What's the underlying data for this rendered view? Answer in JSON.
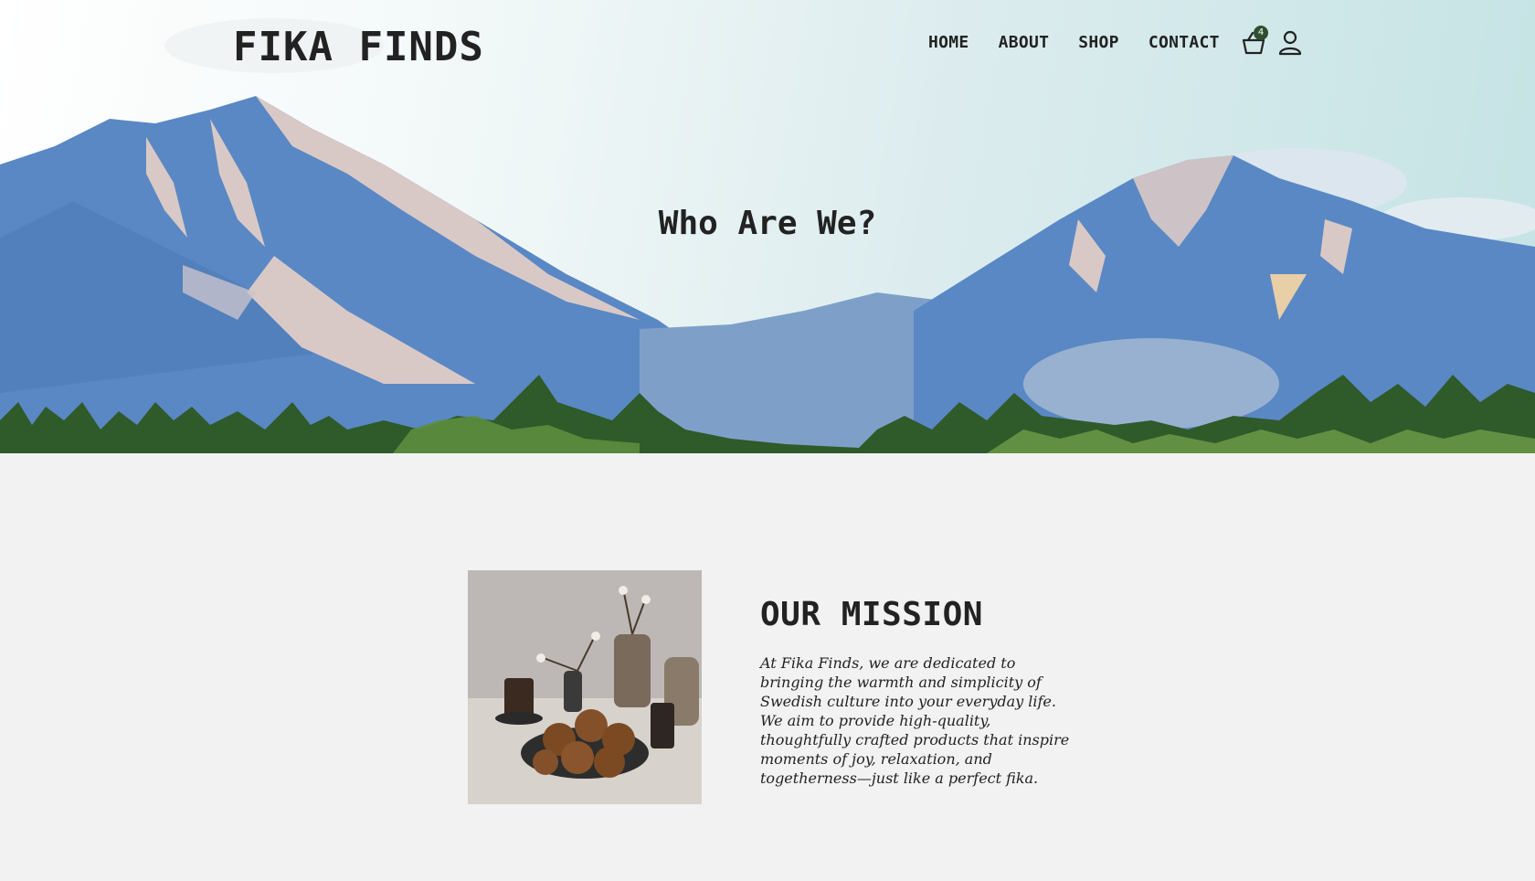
{
  "brand": {
    "name": "FIKA FINDS"
  },
  "nav": {
    "links": [
      "HOME",
      "ABOUT",
      "SHOP",
      "CONTACT"
    ],
    "cart": {
      "icon": "basket-icon",
      "count": "4"
    },
    "account": {
      "icon": "user-icon"
    }
  },
  "hero": {
    "title": "Who Are We?"
  },
  "mission": {
    "heading": "OUR MISSION",
    "body": "At Fika Finds, we are dedicated to bringing the warmth and simplicity of Swedish culture into your everyday life. We aim to provide high-quality, thoughtfully crafted products that inspire moments of joy, relaxation, and togetherness—just like a perfect fika."
  },
  "colors": {
    "mountain": "#5a88c4",
    "snow": "#d9c9c6",
    "tree": "#2f5a2a",
    "page_bg": "#f2f2f2",
    "text": "#222222"
  }
}
